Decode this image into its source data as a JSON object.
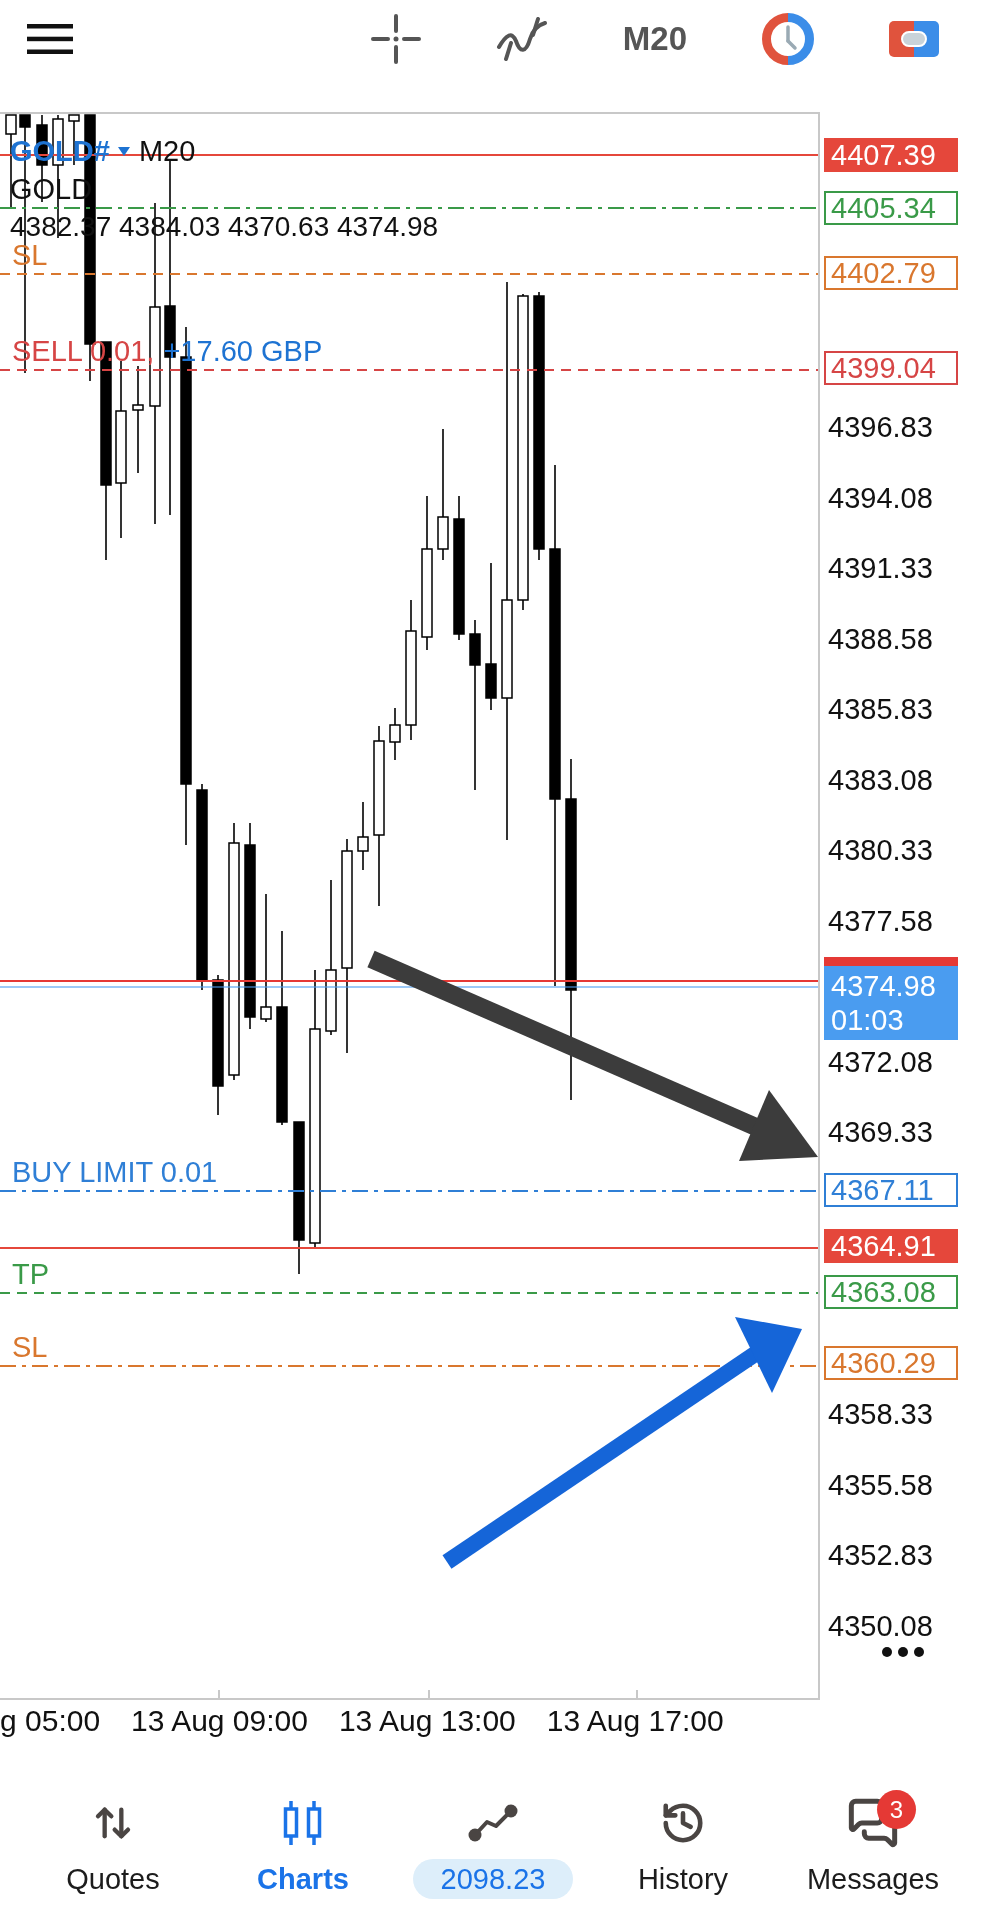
{
  "toolbar": {
    "timeframe": "M20"
  },
  "chart": {
    "symbol": "GOLD#",
    "timeframe": "M20",
    "description": "GOLD",
    "ohlc": "4382.37 4384.03 4370.63 4374.98",
    "levels": [
      {
        "kind": "solid",
        "filled": true,
        "color": "#e5473b",
        "tag": "4407.39"
      },
      {
        "kind": "dashdot",
        "filled": false,
        "color": "#3a9a48",
        "tag": "4405.34"
      },
      {
        "kind": "dashed",
        "filled": false,
        "color": "#d9772e",
        "label": "SL",
        "tag": "4402.79"
      },
      {
        "kind": "dashed",
        "filled": false,
        "color": "#d64545",
        "label": "SELL 0.01,",
        "profit": "+17.60 GBP",
        "tag": "4399.04"
      },
      {
        "kind": "solid",
        "filled": true,
        "color": "#e53935"
      },
      {
        "kind": "solid",
        "filled": true,
        "color": "#4a9cf0",
        "tag": "4374.98",
        "timer": "01:03"
      },
      {
        "kind": "dashdot",
        "filled": false,
        "color": "#2f7fd6",
        "label": "BUY LIMIT 0.01",
        "tag": "4367.11"
      },
      {
        "kind": "solid",
        "filled": true,
        "color": "#e5473b",
        "tag": "4364.91"
      },
      {
        "kind": "dashed",
        "filled": false,
        "color": "#3a9a48",
        "label": "TP",
        "tag": "4363.08"
      },
      {
        "kind": "dashdot",
        "filled": false,
        "color": "#d9772e",
        "label": "SL",
        "tag": "4360.29"
      }
    ],
    "price_ticks": [
      "4396.83",
      "4394.08",
      "4391.33",
      "4388.58",
      "4385.83",
      "4383.08",
      "4380.33",
      "4377.58",
      "4372.08",
      "4369.33",
      "4358.33",
      "4355.58",
      "4352.83",
      "4350.08"
    ],
    "time_labels": [
      "g 05:00",
      "13 Aug 09:00",
      "13 Aug 13:00",
      "13 Aug 17:00"
    ]
  },
  "nav": [
    {
      "kind": "text",
      "label": "Quotes",
      "selected": false
    },
    {
      "kind": "text",
      "label": "Charts",
      "selected": true
    },
    {
      "kind": "pill",
      "label": "2098.23",
      "selected": false
    },
    {
      "kind": "text",
      "label": "History",
      "selected": false
    },
    {
      "kind": "text",
      "label": "Messages",
      "selected": false,
      "badge": "3"
    }
  ]
}
